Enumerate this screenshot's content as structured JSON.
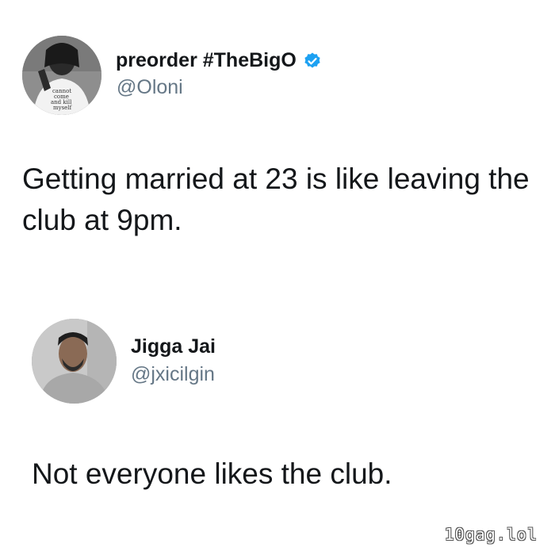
{
  "tweets": [
    {
      "display_name": "preorder #TheBigO",
      "handle": "@Oloni",
      "verified": true,
      "text": "Getting married at 23 is like leaving the club at 9pm.",
      "avatar_shirt_text": "cannot come and kill myself"
    },
    {
      "display_name": "Jigga Jai",
      "handle": "@jxicilgin",
      "verified": false,
      "text": "Not everyone likes the club."
    }
  ],
  "watermark": "10gag.lol",
  "colors": {
    "name": "#14171a",
    "handle": "#657786",
    "verified_badge": "#1da1f2"
  }
}
